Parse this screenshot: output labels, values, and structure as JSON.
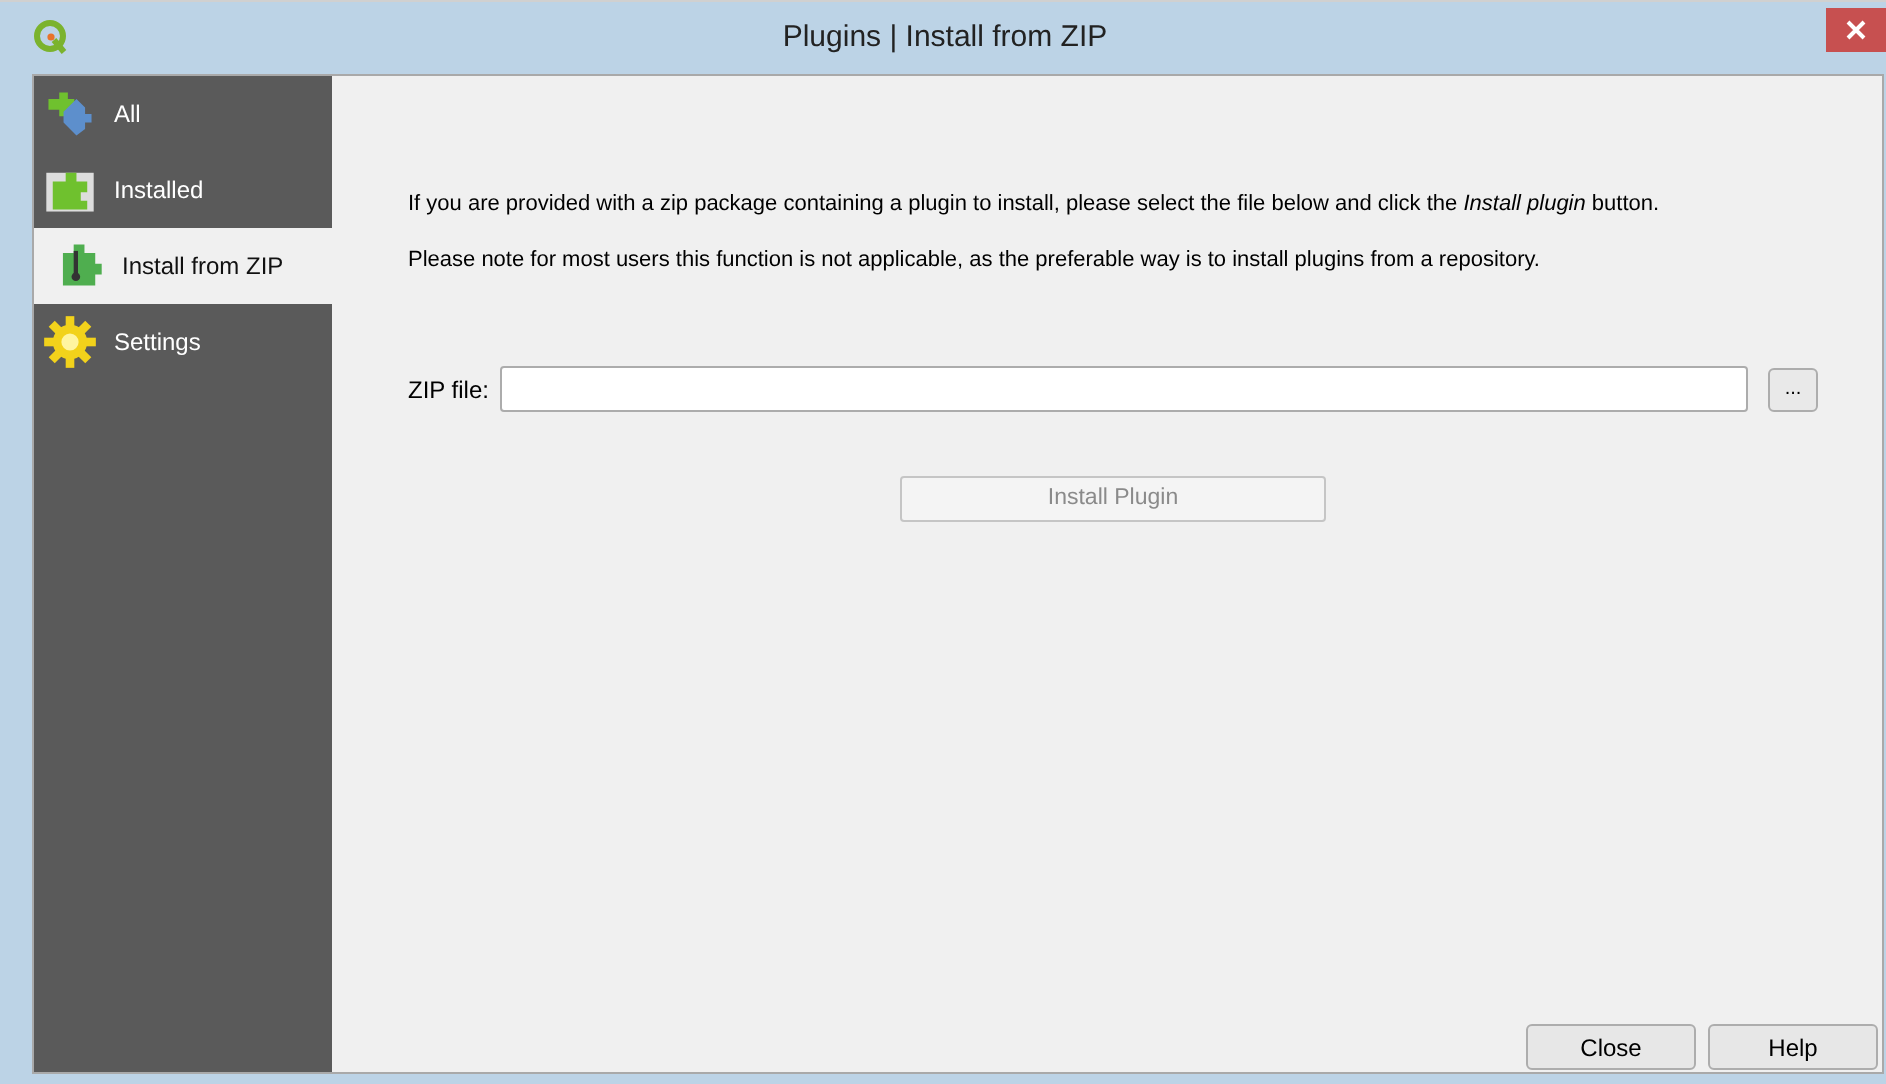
{
  "window": {
    "title": "Plugins | Install from ZIP"
  },
  "sidebar": {
    "items": [
      {
        "label": "All",
        "kind": "all",
        "selected": false
      },
      {
        "label": "Installed",
        "kind": "installed",
        "selected": false
      },
      {
        "label": "Install from ZIP",
        "kind": "zip",
        "selected": true
      },
      {
        "label": "Settings",
        "kind": "settings",
        "selected": false
      }
    ]
  },
  "intro": [
    "If you are provided with a zip package containing a plugin to install, please select the file below and click the *Install plugin* button.",
    "Please note for most users this function is not applicable, as the preferable way is to install plugins from a repository."
  ],
  "zip_file": {
    "label": "ZIP file:",
    "browse": "..."
  },
  "install_button": {
    "label": "Install Plugin",
    "disabled": true
  },
  "buttons": [
    "Close",
    "Help"
  ]
}
